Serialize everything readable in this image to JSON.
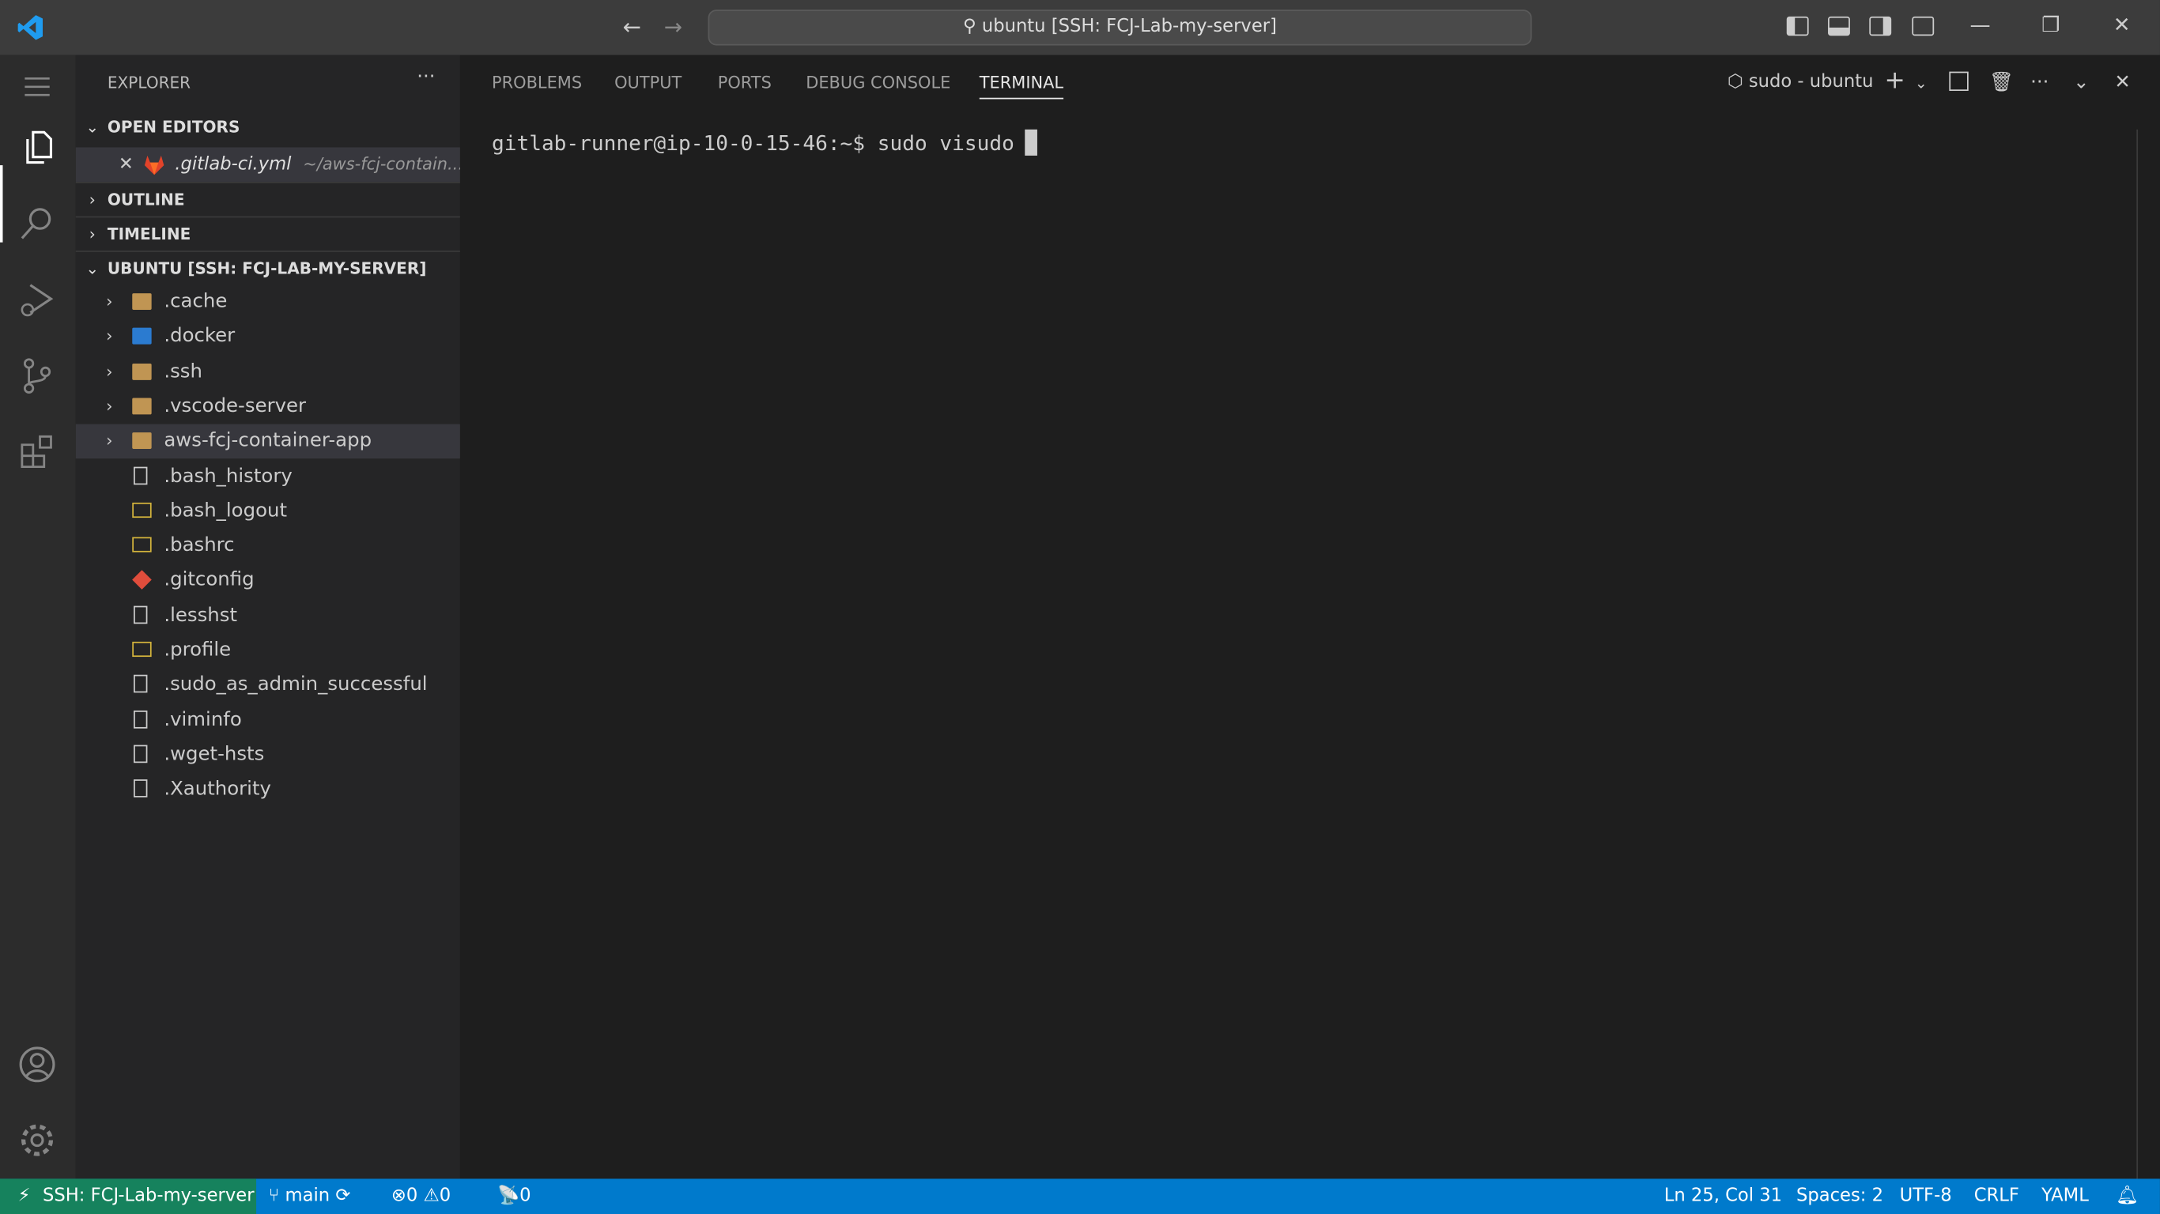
{
  "titlebar": {
    "search": "ubuntu [SSH: FCJ-Lab-my-server]",
    "back": "←",
    "forward": "→",
    "minimize": "—",
    "restore": "❐",
    "close": "✕"
  },
  "explorer": {
    "title": "EXPLORER",
    "more": "···",
    "open_editors": {
      "label": "OPEN EDITORS",
      "items": [
        {
          "name": ".gitlab-ci.yml",
          "path": "~/aws-fcj-contain..."
        }
      ]
    },
    "outline": "OUTLINE",
    "timeline": "TIMELINE",
    "workspace": {
      "label": "UBUNTU [SSH: FCJ-LAB-MY-SERVER]",
      "items": [
        {
          "name": ".cache",
          "type": "folder"
        },
        {
          "name": ".docker",
          "type": "docker-folder"
        },
        {
          "name": ".ssh",
          "type": "folder"
        },
        {
          "name": ".vscode-server",
          "type": "folder"
        },
        {
          "name": "aws-fcj-container-app",
          "type": "folder",
          "selected": true
        },
        {
          "name": ".bash_history",
          "type": "file"
        },
        {
          "name": ".bash_logout",
          "type": "shell"
        },
        {
          "name": ".bashrc",
          "type": "shell"
        },
        {
          "name": ".gitconfig",
          "type": "git"
        },
        {
          "name": ".lesshst",
          "type": "file"
        },
        {
          "name": ".profile",
          "type": "shell"
        },
        {
          "name": ".sudo_as_admin_successful",
          "type": "file"
        },
        {
          "name": ".viminfo",
          "type": "file"
        },
        {
          "name": ".wget-hsts",
          "type": "file"
        },
        {
          "name": ".Xauthority",
          "type": "file"
        }
      ]
    }
  },
  "panel": {
    "tabs": [
      "PROBLEMS",
      "OUTPUT",
      "PORTS",
      "DEBUG CONSOLE",
      "TERMINAL"
    ],
    "active_tab": "TERMINAL",
    "terminal_name": "sudo - ubuntu",
    "terminal_line": "gitlab-runner@ip-10-0-15-46:~$ sudo visudo"
  },
  "statusbar": {
    "remote": "SSH: FCJ-Lab-my-server",
    "branch": "main",
    "errors": "0",
    "warnings": "0",
    "ports": "0",
    "position": "Ln 25, Col 31",
    "spaces": "Spaces: 2",
    "encoding": "UTF-8",
    "eol": "CRLF",
    "language": "YAML"
  },
  "colors": {
    "accent": "#007acc",
    "remote": "#16825d",
    "folder": "#c09553"
  }
}
